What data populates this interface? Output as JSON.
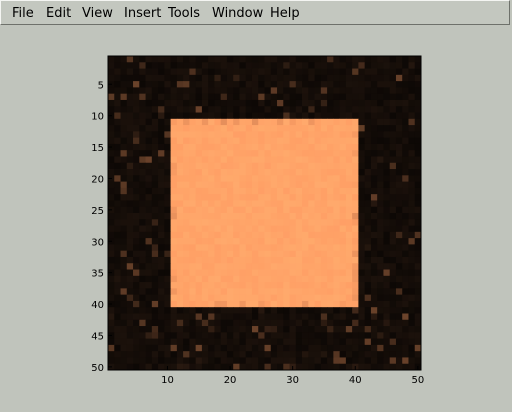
{
  "menu": {
    "file": "File",
    "edit": "Edit",
    "view": "View",
    "insert": "Insert",
    "tools": "Tools",
    "window": "Window",
    "help": "Help"
  },
  "colors": {
    "background_dark": "#120b05",
    "square_fill": "#fdb77f",
    "window_bg": "#c0c4bc"
  },
  "chart_data": {
    "type": "heatmap",
    "grid_size": [
      50,
      50
    ],
    "xlim": [
      0.5,
      50.5
    ],
    "ylim": [
      0.5,
      50.5
    ],
    "y_reversed": true,
    "x_ticks": [
      "10",
      "20",
      "30",
      "40",
      "50"
    ],
    "y_ticks": [
      "5",
      "10",
      "15",
      "20",
      "25",
      "30",
      "35",
      "40",
      "45",
      "50"
    ],
    "square_region": {
      "x_range": [
        11,
        40
      ],
      "y_range": [
        11,
        40
      ]
    },
    "colormap": "copper"
  }
}
